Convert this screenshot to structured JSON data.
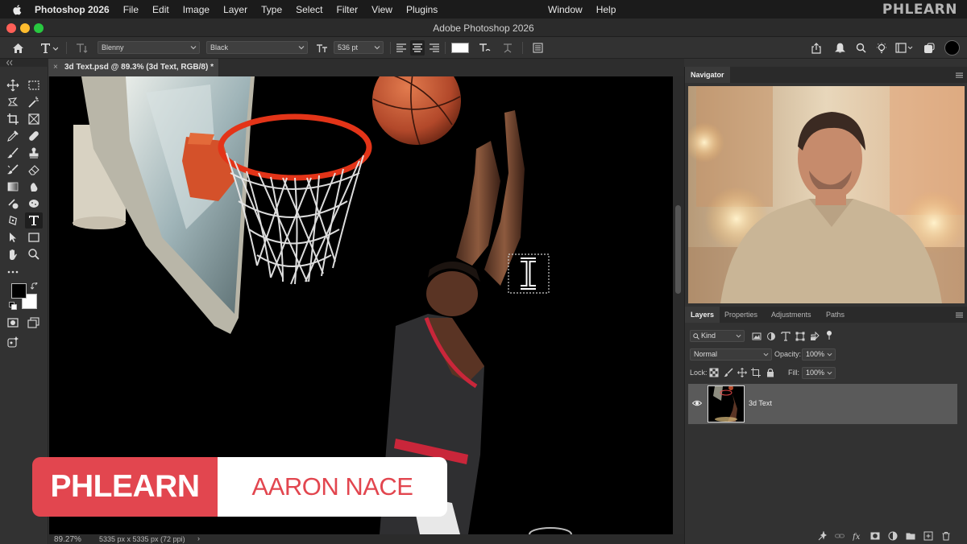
{
  "menubar": {
    "app_name": "Photoshop 2026",
    "items": [
      "File",
      "Edit",
      "Image",
      "Layer",
      "Type",
      "Select",
      "Filter",
      "View",
      "Plugins"
    ],
    "right_items": [
      "Window",
      "Help"
    ],
    "brand_watermark": "PHLEARN"
  },
  "window": {
    "title": "Adobe Photoshop 2026"
  },
  "options_bar": {
    "font_family": "Blenny",
    "font_style": "Black",
    "font_size": "536 pt",
    "alignment_selected": "center",
    "text_color": "#ffffff"
  },
  "document": {
    "tab_label": "3d Text.psd @ 89.3% (3d Text, RGB/8) *",
    "zoom": "89.27%",
    "dimensions": "5335 px x 5335 px (72 ppi)",
    "status_arrow": "›"
  },
  "toolbox": {
    "active_tool": "type-tool",
    "foreground_color": "#000000",
    "background_color": "#ffffff"
  },
  "lower_third": {
    "brand": "PHLEARN",
    "presenter": "AARON NACE",
    "accent_color": "#e2464f"
  },
  "navigator": {
    "tab_label": "Navigator"
  },
  "layers_panel": {
    "tabs": [
      "Layers",
      "Properties",
      "Adjustments",
      "Paths"
    ],
    "active_tab": "Layers",
    "filter_kind": "Kind",
    "blend_mode": "Normal",
    "opacity_label": "Opacity:",
    "opacity_value": "100%",
    "lock_label": "Lock:",
    "fill_label": "Fill:",
    "fill_value": "100%",
    "layers": [
      {
        "name": "3d Text",
        "visible": true,
        "selected": true
      }
    ]
  }
}
